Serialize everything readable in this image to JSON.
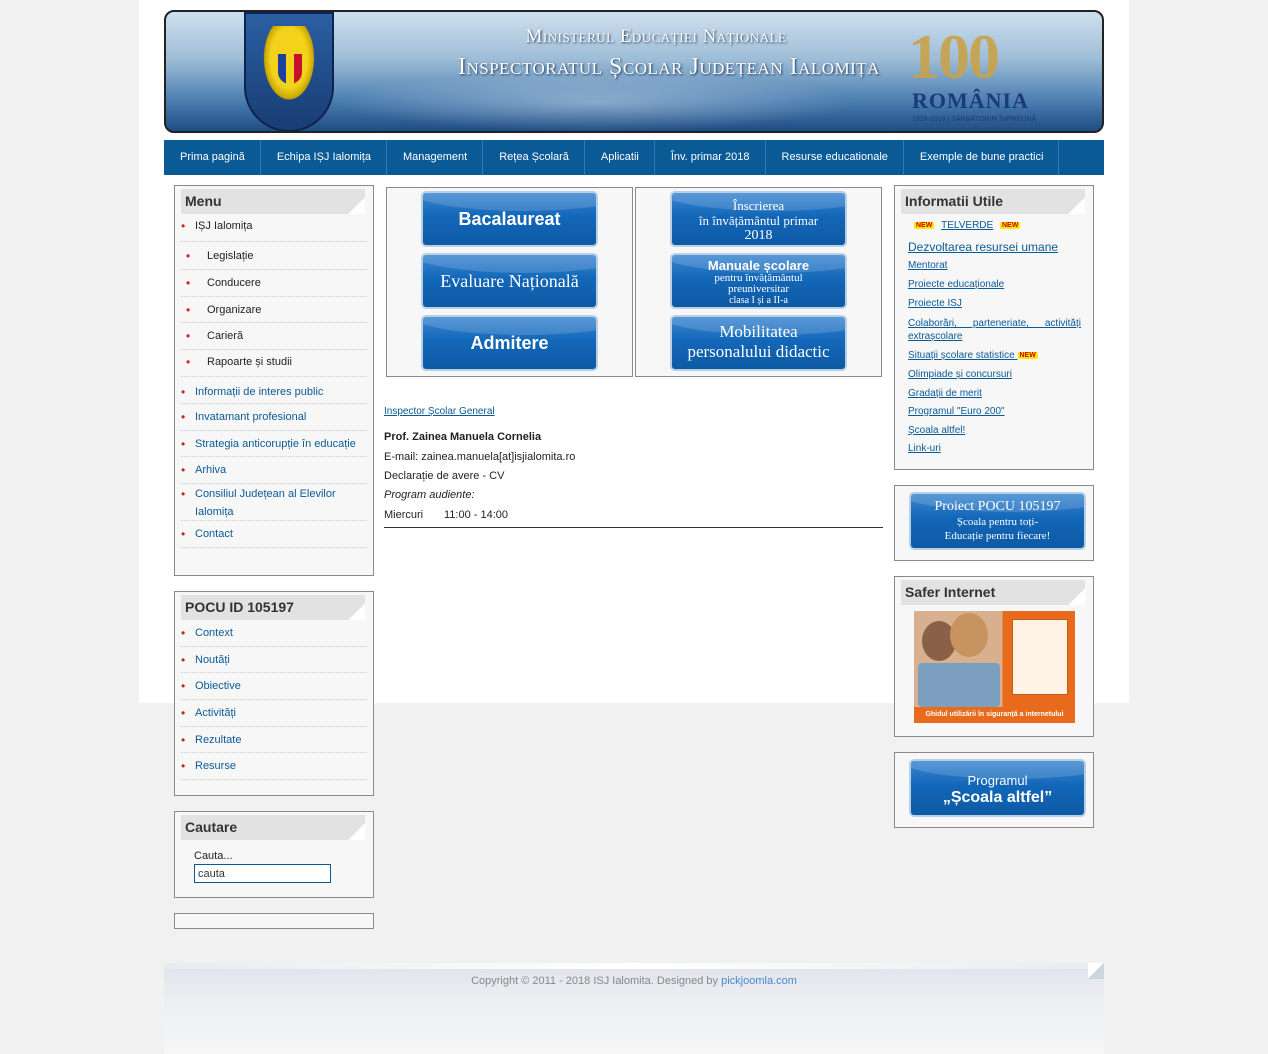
{
  "header": {
    "line1": "Ministerul Educației Naționale",
    "line2": "Inspectoratul Școlar Județean Ialomița",
    "centenary_number": "100",
    "centenary_word": "ROMÂNIA",
    "centenary_sub": "1918-2018 | SĂRBĂTORIM ÎMPREUNĂ"
  },
  "nav": [
    "Prima pagină",
    "Echipa IȘJ Ialomița",
    "Management",
    "Rețea Școlară",
    "Aplicatii",
    "Înv. primar 2018",
    "Resurse educationale",
    "Exemple de bune practici"
  ],
  "menu": {
    "title": "Menu",
    "items": [
      {
        "label": "IȘJ Ialomița"
      },
      {
        "label": "Legislație"
      },
      {
        "label": "Conducere"
      },
      {
        "label": "Organizare"
      },
      {
        "label": "Carieră"
      },
      {
        "label": "Rapoarte și studii"
      },
      {
        "label": "Informații de interes public"
      },
      {
        "label": "Invatamant profesional"
      },
      {
        "label": "Strategia anticorupție în educație"
      },
      {
        "label": "Arhiva"
      },
      {
        "label": "Consiliul Județean al Elevilor Ialomița"
      },
      {
        "label": "Contact"
      }
    ]
  },
  "pocu": {
    "title": "POCU ID 105197",
    "items": [
      "Context",
      "Noutăți",
      "Obiective",
      "Activități",
      "Rezultate",
      "Resurse"
    ]
  },
  "search": {
    "title": "Cautare",
    "label": "Cauta...",
    "value": "cauta"
  },
  "banners": {
    "bac": "Bacalaureat",
    "en": "Evaluare Națională",
    "admitere": "Admitere",
    "inscriere_1": "Înscrierea",
    "inscriere_2": "în învățământul primar",
    "inscriere_3": "2018",
    "manuale_1": "Manuale școlare",
    "manuale_2": "pentru învățământul",
    "manuale_3": "preuniversitar",
    "manuale_4": "clasa I și a II-a",
    "mobilitate_1": "Mobilitatea",
    "mobilitate_2": "personalului didactic"
  },
  "inspector": {
    "link": "Inspector Școlar General",
    "name": "Prof. Zainea Manuela Cornelia",
    "email": "E-mail: zainea.manuela[at]isjialomita.ro",
    "declaratie": "Declarație de avere - CV",
    "program_label": "Program audiente:",
    "day": "Miercuri",
    "hours": "11:00 - 14:00"
  },
  "util": {
    "title": "Informatii Utile",
    "new_badge": "NEW",
    "telverde": "TELVERDE",
    "dezvoltarea": "Dezvoltarea resursei umane",
    "links": [
      "Mentorat",
      "Proiecte educaționale",
      "Proiecte ISJ",
      "Colaborări, parteneriate, activități extrașcolare",
      "Situații școlare statistice",
      "Olimpiade și concursuri",
      "Gradații de merit",
      "Programul \"Euro 200\"",
      "Școala altfel!",
      "Link-uri"
    ]
  },
  "pocu_banner": {
    "line1": "Proiect POCU 105197",
    "line2": "Școala pentru toți-",
    "line3": "Educație pentru fiecare!"
  },
  "safer": {
    "title": "Safer Internet",
    "caption": "Ghidul utilizării în siguranță a internetului"
  },
  "scoala_altfel": {
    "line1": "Programul",
    "line2": "„Școala altfel”"
  },
  "footer": {
    "copyright": "Copyright © 2011 - 2018 ISJ Ialomita. Designed by ",
    "designer": "pickjoomla.com"
  }
}
